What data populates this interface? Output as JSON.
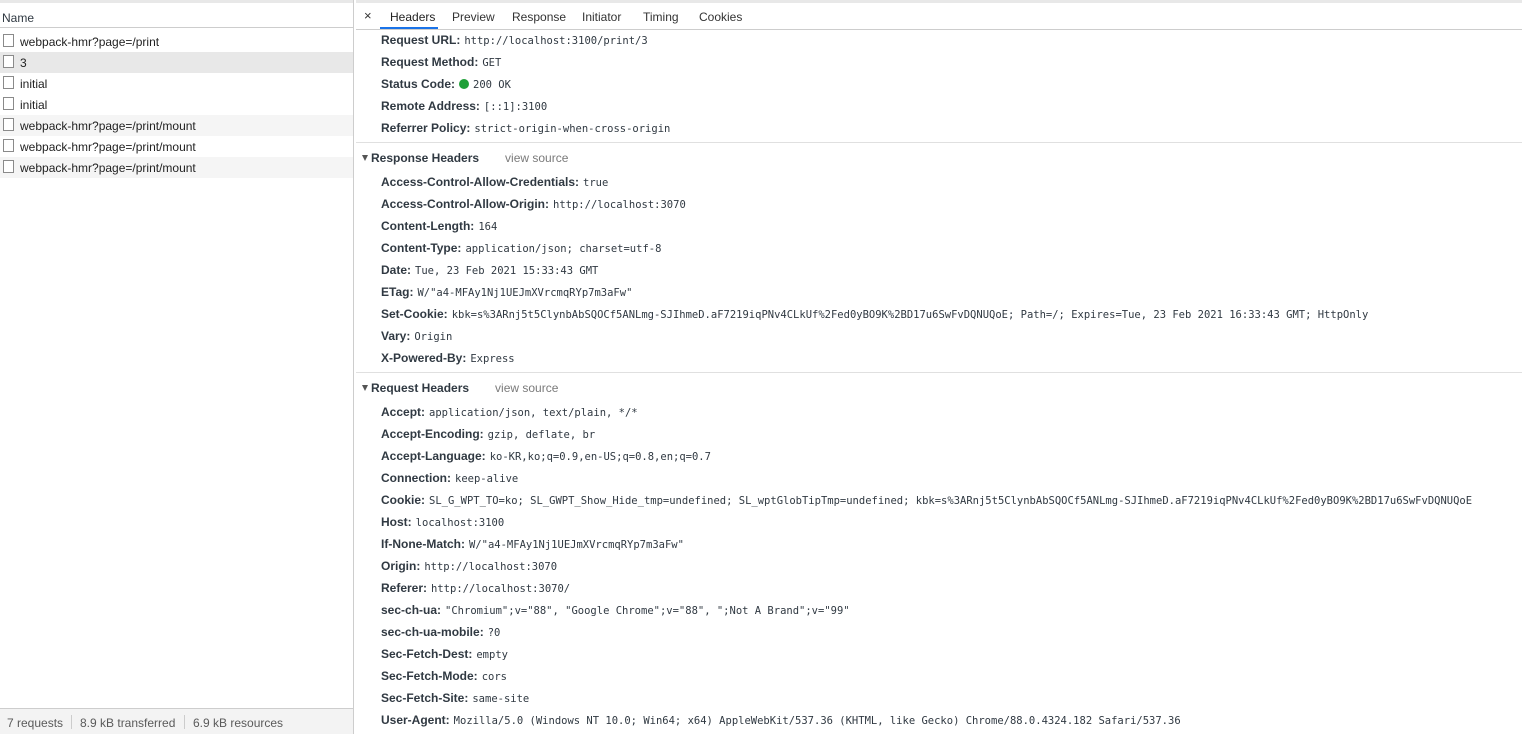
{
  "left_panel": {
    "column_header": "Name",
    "requests": [
      {
        "name": "webpack-hmr?page=/print"
      },
      {
        "name": "3"
      },
      {
        "name": "initial"
      },
      {
        "name": "initial"
      },
      {
        "name": "webpack-hmr?page=/print/mount"
      },
      {
        "name": "webpack-hmr?page=/print/mount"
      },
      {
        "name": "webpack-hmr?page=/print/mount"
      }
    ],
    "footer": {
      "requests": "7 requests",
      "transferred": "8.9 kB transferred",
      "resources": "6.9 kB resources"
    }
  },
  "detail_panel": {
    "close_icon": "×",
    "tabs": [
      "Headers",
      "Preview",
      "Response",
      "Initiator",
      "Timing",
      "Cookies"
    ],
    "active_tab": "Headers",
    "general": [
      {
        "key": "Request URL:",
        "value": "http://localhost:3100/print/3"
      },
      {
        "key": "Request Method:",
        "value": "GET"
      },
      {
        "key": "Status Code:",
        "value": "200 OK",
        "status_color": "#1fa038"
      },
      {
        "key": "Remote Address:",
        "value": "[::1]:3100"
      },
      {
        "key": "Referrer Policy:",
        "value": "strict-origin-when-cross-origin"
      }
    ],
    "response_headers": {
      "title": "Response Headers",
      "view_source": "view source",
      "items": [
        {
          "key": "Access-Control-Allow-Credentials:",
          "value": "true"
        },
        {
          "key": "Access-Control-Allow-Origin:",
          "value": "http://localhost:3070"
        },
        {
          "key": "Content-Length:",
          "value": "164"
        },
        {
          "key": "Content-Type:",
          "value": "application/json; charset=utf-8"
        },
        {
          "key": "Date:",
          "value": "Tue, 23 Feb 2021 15:33:43 GMT"
        },
        {
          "key": "ETag:",
          "value": "W/\"a4-MFAy1Nj1UEJmXVrcmqRYp7m3aFw\""
        },
        {
          "key": "Set-Cookie:",
          "value": "kbk=s%3ARnj5t5ClynbAbSQOCf5ANLmg-SJIhmeD.aF7219iqPNv4CLkUf%2Fed0yBO9K%2BD17u6SwFvDQNUQoE; Path=/; Expires=Tue, 23 Feb 2021 16:33:43 GMT; HttpOnly"
        },
        {
          "key": "Vary:",
          "value": "Origin"
        },
        {
          "key": "X-Powered-By:",
          "value": "Express"
        }
      ]
    },
    "request_headers": {
      "title": "Request Headers",
      "view_source": "view source",
      "items": [
        {
          "key": "Accept:",
          "value": "application/json, text/plain, */*"
        },
        {
          "key": "Accept-Encoding:",
          "value": "gzip, deflate, br"
        },
        {
          "key": "Accept-Language:",
          "value": "ko-KR,ko;q=0.9,en-US;q=0.8,en;q=0.7"
        },
        {
          "key": "Connection:",
          "value": "keep-alive"
        },
        {
          "key": "Cookie:",
          "value": "SL_G_WPT_TO=ko; SL_GWPT_Show_Hide_tmp=undefined; SL_wptGlobTipTmp=undefined; kbk=s%3ARnj5t5ClynbAbSQOCf5ANLmg-SJIhmeD.aF7219iqPNv4CLkUf%2Fed0yBO9K%2BD17u6SwFvDQNUQoE"
        },
        {
          "key": "Host:",
          "value": "localhost:3100"
        },
        {
          "key": "If-None-Match:",
          "value": "W/\"a4-MFAy1Nj1UEJmXVrcmqRYp7m3aFw\""
        },
        {
          "key": "Origin:",
          "value": "http://localhost:3070"
        },
        {
          "key": "Referer:",
          "value": "http://localhost:3070/"
        },
        {
          "key": "sec-ch-ua:",
          "value": "\"Chromium\";v=\"88\", \"Google Chrome\";v=\"88\", \";Not A Brand\";v=\"99\""
        },
        {
          "key": "sec-ch-ua-mobile:",
          "value": "?0"
        },
        {
          "key": "Sec-Fetch-Dest:",
          "value": "empty"
        },
        {
          "key": "Sec-Fetch-Mode:",
          "value": "cors"
        },
        {
          "key": "Sec-Fetch-Site:",
          "value": "same-site"
        },
        {
          "key": "User-Agent:",
          "value": "Mozilla/5.0 (Windows NT 10.0; Win64; x64) AppleWebKit/537.36 (KHTML, like Gecko) Chrome/88.0.4324.182 Safari/537.36"
        }
      ]
    }
  }
}
